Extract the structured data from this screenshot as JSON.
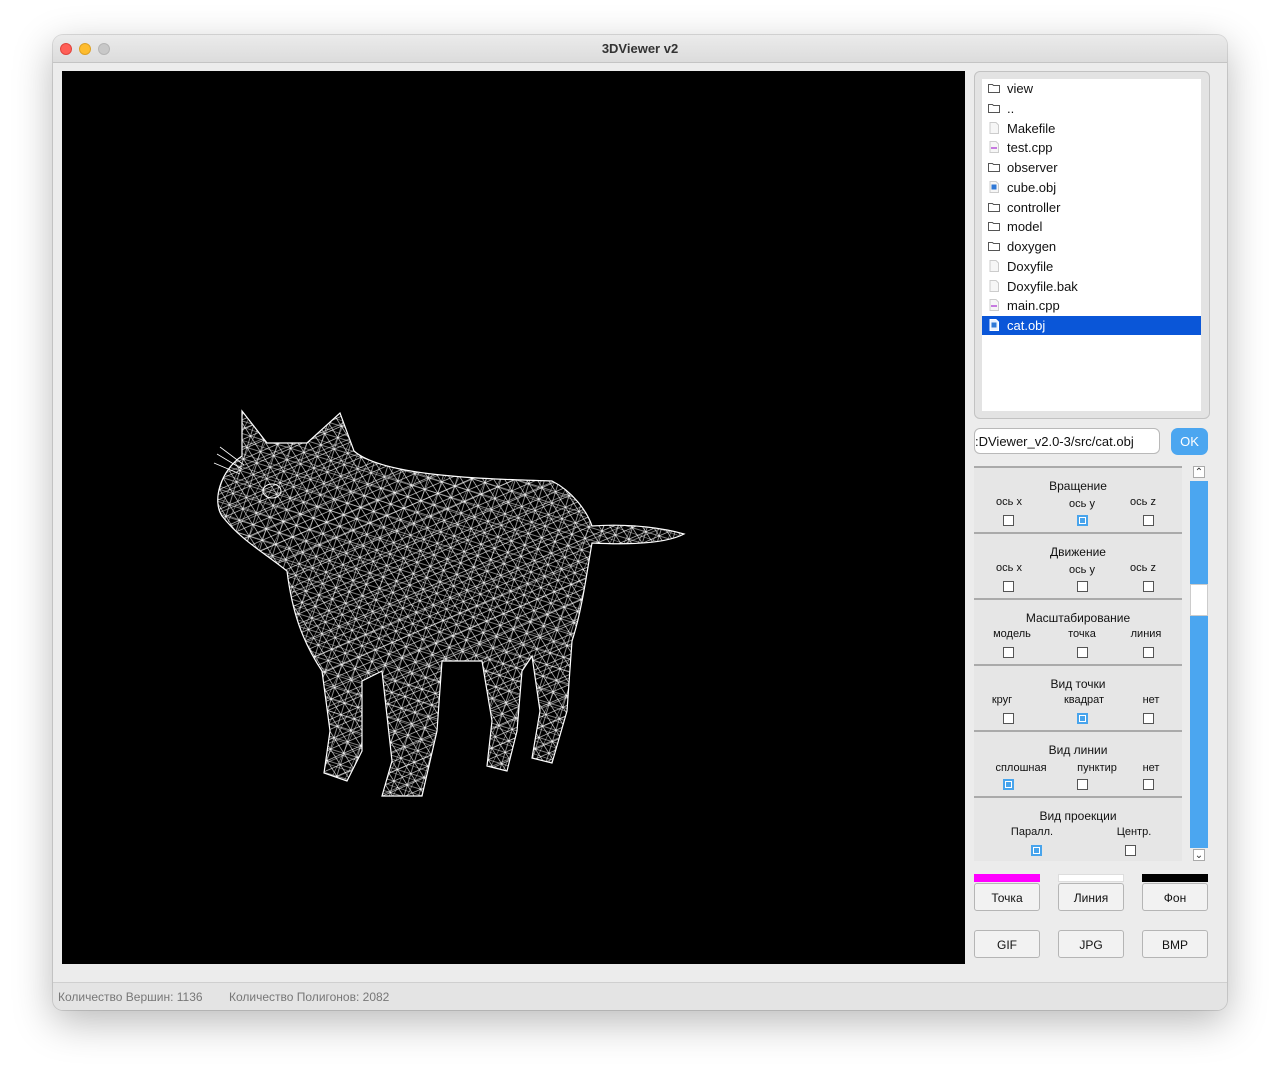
{
  "window": {
    "title": "3DViewer v2"
  },
  "files": [
    {
      "name": "view",
      "type": "folder"
    },
    {
      "name": "..",
      "type": "folder"
    },
    {
      "name": "Makefile",
      "type": "file"
    },
    {
      "name": "test.cpp",
      "type": "cpp"
    },
    {
      "name": "observer",
      "type": "folder"
    },
    {
      "name": "cube.obj",
      "type": "obj"
    },
    {
      "name": "controller",
      "type": "folder"
    },
    {
      "name": "model",
      "type": "folder"
    },
    {
      "name": "doxygen",
      "type": "folder"
    },
    {
      "name": "Doxyfile",
      "type": "file"
    },
    {
      "name": "Doxyfile.bak",
      "type": "file"
    },
    {
      "name": "main.cpp",
      "type": "cpp"
    },
    {
      "name": "cat.obj",
      "type": "obj",
      "selected": true
    }
  ],
  "path": {
    "value": ":DViewer_v2.0-3/src/cat.obj"
  },
  "ok_label": "OK",
  "groups": {
    "rotation": {
      "title": "Вращение",
      "opts": [
        "ось x",
        "ось y",
        "ось z"
      ],
      "checked": [
        false,
        true,
        false
      ]
    },
    "movement": {
      "title": "Движение",
      "opts": [
        "ось x",
        "ось y",
        "ось z"
      ],
      "checked": [
        false,
        false,
        false
      ]
    },
    "scaling": {
      "title": "Масштабирование",
      "opts": [
        "модель",
        "точка",
        "линия"
      ],
      "checked": [
        false,
        false,
        false
      ]
    },
    "point_view": {
      "title": "Вид точки",
      "opts": [
        "круг",
        "квадрат",
        "нет"
      ],
      "checked": [
        false,
        true,
        false
      ]
    },
    "line_view": {
      "title": "Вид линии",
      "opts": [
        "сплошная",
        "пунктир",
        "нет"
      ],
      "checked": [
        true,
        false,
        false
      ]
    },
    "projection": {
      "title": "Вид проекции",
      "opts": [
        "Паралл.",
        "Центр."
      ],
      "checked": [
        true,
        false
      ]
    }
  },
  "colors": {
    "point": "#ff00ff",
    "line": "#ffffff",
    "background": "#000000",
    "accent": "#4ba6f0",
    "selection": "#0a56d8"
  },
  "color_buttons": {
    "point": "Точка",
    "line": "Линия",
    "background": "Фон"
  },
  "export_buttons": {
    "gif": "GIF",
    "jpg": "JPG",
    "bmp": "BMP"
  },
  "status": {
    "vertices": "Количество Вершин: 1136",
    "polygons": "Количество Полигонов: 2082"
  }
}
